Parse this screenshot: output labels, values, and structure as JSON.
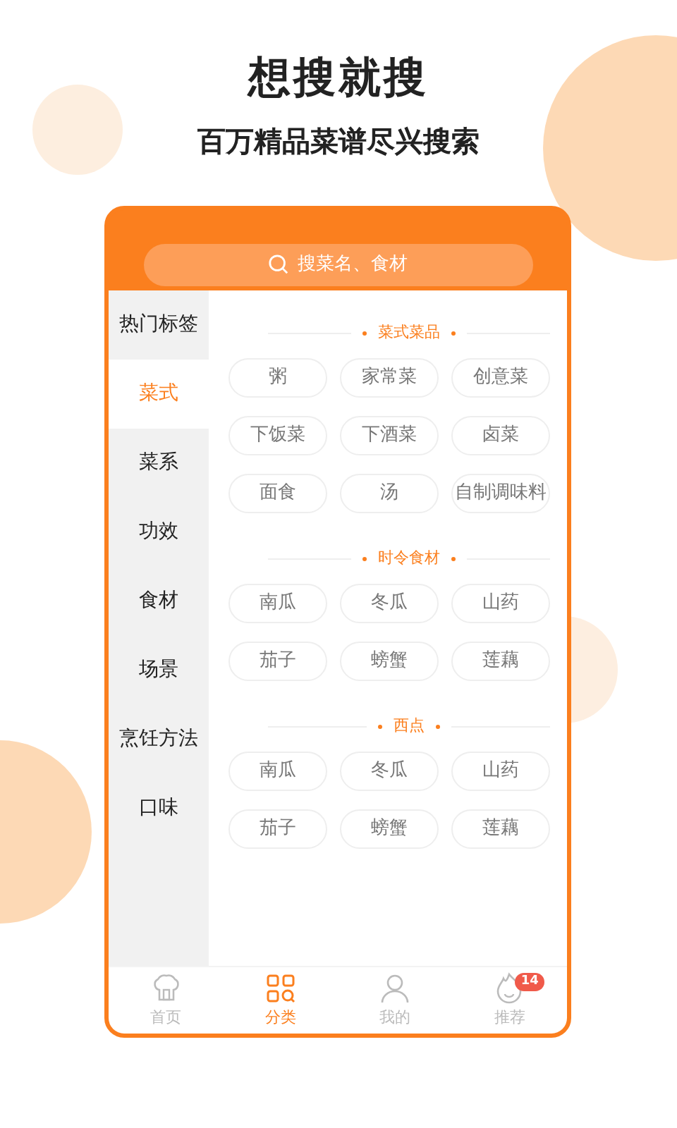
{
  "headline": "想搜就搜",
  "subtitle": "百万精品菜谱尽兴搜索",
  "search": {
    "placeholder": "搜菜名、食材"
  },
  "sidebar": {
    "items": [
      {
        "label": "热门标签",
        "selected": false
      },
      {
        "label": "菜式",
        "selected": true
      },
      {
        "label": "菜系",
        "selected": false
      },
      {
        "label": "功效",
        "selected": false
      },
      {
        "label": "食材",
        "selected": false
      },
      {
        "label": "场景",
        "selected": false
      },
      {
        "label": "烹饪方法",
        "selected": false
      },
      {
        "label": "口味",
        "selected": false
      }
    ]
  },
  "sections": [
    {
      "title": "菜式菜品",
      "tags": [
        "粥",
        "家常菜",
        "创意菜",
        "下饭菜",
        "下酒菜",
        "卤菜",
        "面食",
        "汤",
        "自制调味料"
      ]
    },
    {
      "title": "时令食材",
      "tags": [
        "南瓜",
        "冬瓜",
        "山药",
        "茄子",
        "螃蟹",
        "莲藕"
      ]
    },
    {
      "title": "西点",
      "tags": [
        "南瓜",
        "冬瓜",
        "山药",
        "茄子",
        "螃蟹",
        "莲藕"
      ]
    }
  ],
  "tab_bar": [
    {
      "label": "首页",
      "selected": false
    },
    {
      "label": "分类",
      "selected": true
    },
    {
      "label": "我的",
      "selected": false
    },
    {
      "label": "推荐",
      "selected": false,
      "badge": "14"
    }
  ]
}
